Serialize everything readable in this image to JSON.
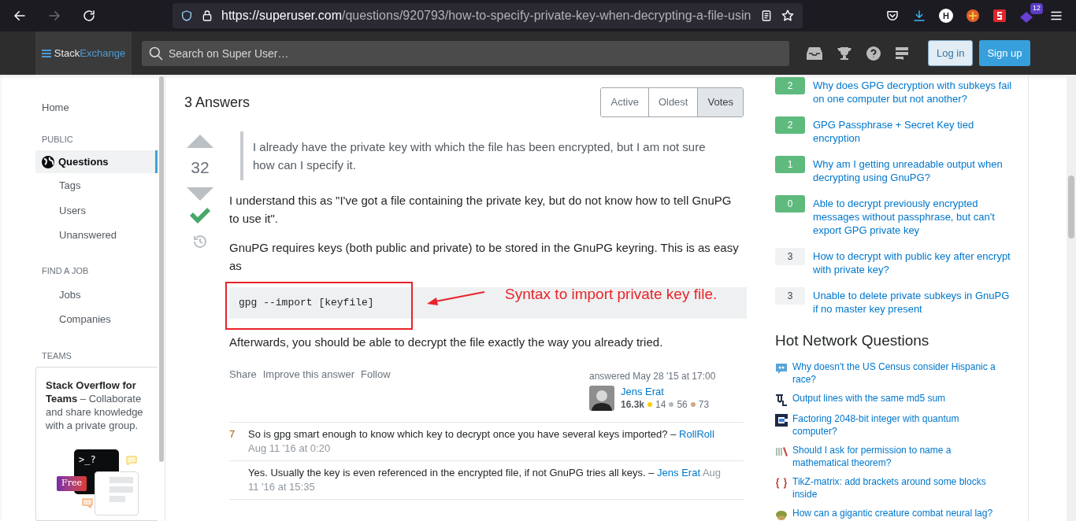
{
  "browser": {
    "url_host": "https://superuser.com",
    "url_path": "/questions/920793/how-to-specify-private-key-when-decrypting-a-file-usin",
    "badge": "12",
    "account": "H"
  },
  "header": {
    "logo_a": "Stack",
    "logo_b": "Exchange",
    "search": {
      "placeholder": "Search on Super User…"
    },
    "login": "Log in",
    "signup": "Sign up"
  },
  "nav": {
    "items": [
      {
        "kind": "link",
        "label": "Home",
        "selected": false
      },
      {
        "kind": "heading",
        "label": "PUBLIC"
      },
      {
        "kind": "main",
        "label": "Questions",
        "selected": true
      },
      {
        "kind": "sub",
        "label": "Tags",
        "selected": false
      },
      {
        "kind": "sub",
        "label": "Users",
        "selected": false
      },
      {
        "kind": "sub",
        "label": "Unanswered",
        "selected": false
      },
      {
        "kind": "heading",
        "label": "FIND A JOB"
      },
      {
        "kind": "sub",
        "label": "Jobs",
        "selected": false
      },
      {
        "kind": "sub",
        "label": "Companies",
        "selected": false
      },
      {
        "kind": "heading",
        "label": "TEAMS"
      }
    ],
    "teams": {
      "text": "**Stack Overflow for Teams** – Collaborate and share knowledge with a private group.",
      "badge": "Free",
      "prompt": ">_?"
    }
  },
  "answers": {
    "title": "3 Answers",
    "sort_tabs": [
      {
        "label": "Active",
        "selected": false
      },
      {
        "label": "Oldest",
        "selected": false
      },
      {
        "label": "Votes",
        "selected": true
      }
    ],
    "answer": {
      "votes": "32",
      "accepted": true,
      "quote": "I already have the private key with which the file has been encrypted, but I am not sure how can I specify it.",
      "paragraphs": [
        "I understand this as \"I've got a file containing the private key, but do not know how to tell GnuPG to use it\".",
        "GnuPG requires keys (both public and private) to be stored in the GnuPG keyring. This is as easy as"
      ],
      "code": "gpg --import [keyfile]",
      "annotation": "Syntax to import private key file.",
      "after": "Afterwards, you should be able to decrypt the file exactly the way you already tried.",
      "actions": [
        "Share",
        "Improve this answer",
        "Follow"
      ],
      "answered": "answered May 28 '15 at 17:00",
      "user": {
        "name": "Jens Erat",
        "rep": "16.3k",
        "gold": "14",
        "silver": "56",
        "bronze": "73"
      },
      "comments": [
        {
          "score": "7",
          "text": "So is gpg smart enough to know which key to decrypt once you have several keys imported? –",
          "user": "RollRoll",
          "date": "Aug 11 '16 at 0:20"
        },
        {
          "text": "Yes. Usually the key is even referenced in the encrypted file, if not GnuPG tries all keys. –",
          "user": "Jens Erat",
          "date": "Aug 11 '16 at 15:35"
        }
      ]
    }
  },
  "related": [
    {
      "score": "2",
      "accepted": true,
      "title": "Why does GPG decryption with subkeys fail on one computer but not another?"
    },
    {
      "score": "2",
      "accepted": true,
      "title": "GPG Passphrase + Secret Key tied encryption"
    },
    {
      "score": "1",
      "accepted": true,
      "title": "Why am I getting unreadable output when decrypting using GnuPG?"
    },
    {
      "score": "0",
      "accepted": true,
      "title": "Able to decrypt previously encrypted messages without passphrase, but can't export GPG private key"
    },
    {
      "score": "3",
      "accepted": false,
      "title": "How to decrypt with public key after encrypt with private key?"
    },
    {
      "score": "3",
      "accepted": false,
      "title": "Unable to delete private subkeys in GnuPG if no master key present"
    }
  ],
  "hot": {
    "title": "Hot Network Questions",
    "items": [
      "Why doesn't the US Census consider Hispanic a race?",
      "Output lines with the same md5 sum",
      "Factoring 2048-bit integer with quantum computer?",
      "Should I ask for permission to name a mathematical theorem?",
      "TikZ-matrix: add brackets around some blocks inside",
      "How can a gigantic creature combat neural lag?"
    ]
  }
}
